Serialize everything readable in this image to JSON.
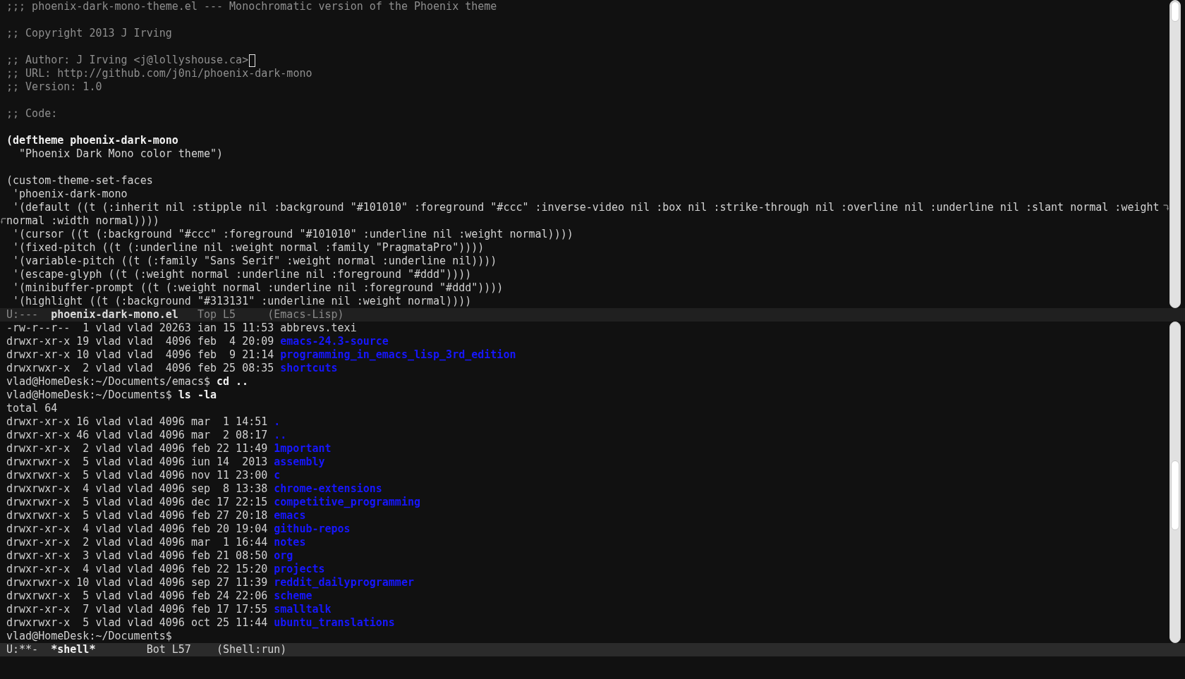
{
  "top_window": {
    "lines": [
      {
        "kind": "comment",
        "text": ";;; phoenix-dark-mono-theme.el --- Monochromatic version of the Phoenix theme",
        "cursor": false
      },
      {
        "kind": "blank",
        "cursor": false
      },
      {
        "kind": "comment",
        "text": ";; Copyright 2013 J Irving",
        "cursor": false
      },
      {
        "kind": "blank",
        "cursor": false
      },
      {
        "kind": "comment",
        "text": ";; Author: J Irving <j@lollyshouse.ca>",
        "cursor": true
      },
      {
        "kind": "comment",
        "text": ";; URL: http://github.com/j0ni/phoenix-dark-mono",
        "cursor": false
      },
      {
        "kind": "comment",
        "text": ";; Version: 1.0",
        "cursor": false
      },
      {
        "kind": "blank",
        "cursor": false
      },
      {
        "kind": "comment",
        "text": ";; Code:",
        "cursor": false
      },
      {
        "kind": "blank",
        "cursor": false
      },
      {
        "kind": "definition",
        "text": "(deftheme phoenix-dark-mono",
        "cursor": false
      },
      {
        "kind": "code",
        "text": "  \"Phoenix Dark Mono color theme\")",
        "cursor": false
      },
      {
        "kind": "blank",
        "cursor": false
      },
      {
        "kind": "code",
        "text": "(custom-theme-set-faces",
        "cursor": false
      },
      {
        "kind": "code",
        "text": " 'phoenix-dark-mono",
        "cursor": false
      },
      {
        "kind": "wrapped",
        "text": " '(default ((t (:inherit nil :stipple nil :background \"#101010\" :foreground \"#ccc\" :inverse-video nil :box nil :strike-through nil :overline nil :underline nil :slant normal :weight",
        "cursor": false
      },
      {
        "kind": "continued",
        "text": "normal :width normal))))",
        "cursor": false
      },
      {
        "kind": "code",
        "text": " '(cursor ((t (:background \"#ccc\" :foreground \"#101010\" :underline nil :weight normal))))",
        "cursor": false
      },
      {
        "kind": "code",
        "text": " '(fixed-pitch ((t (:underline nil :weight normal :family \"PragmataPro\"))))",
        "cursor": false
      },
      {
        "kind": "code",
        "text": " '(variable-pitch ((t (:family \"Sans Serif\" :weight normal :underline nil))))",
        "cursor": false
      },
      {
        "kind": "code",
        "text": " '(escape-glyph ((t (:weight normal :underline nil :foreground \"#ddd\"))))",
        "cursor": false
      },
      {
        "kind": "code",
        "text": " '(minibuffer-prompt ((t (:weight normal :underline nil :foreground \"#ddd\"))))",
        "cursor": false
      },
      {
        "kind": "code",
        "text": " '(highlight ((t (:background \"#313131\" :underline nil :weight normal))))",
        "cursor": false
      }
    ],
    "mode_line": {
      "status": "U:---",
      "buffer": "phoenix-dark-mono.el",
      "position": "Top L5",
      "mode": "(Emacs-Lisp)",
      "active": false
    }
  },
  "bottom_window": {
    "lines": [
      {
        "kind": "entry",
        "info": "-rw-r--r--  1 vlad vlad 20263 ian 15 11:53",
        "name": "abbrevs.texi",
        "directory": false
      },
      {
        "kind": "entry",
        "info": "drwxr-xr-x 19 vlad vlad  4096 feb  4 20:09",
        "name": "emacs-24.3-source",
        "directory": true
      },
      {
        "kind": "entry",
        "info": "drwxr-xr-x 10 vlad vlad  4096 feb  9 21:14",
        "name": "programming_in_emacs_lisp_3rd_edition",
        "directory": true
      },
      {
        "kind": "entry",
        "info": "drwxrwxr-x  2 vlad vlad  4096 feb 25 08:35",
        "name": "shortcuts",
        "directory": true
      },
      {
        "kind": "prompt",
        "prompt": "vlad@HomeDesk:~/Documents/emacs$",
        "command": "cd .."
      },
      {
        "kind": "prompt",
        "prompt": "vlad@HomeDesk:~/Documents$",
        "command": "ls -la"
      },
      {
        "kind": "output",
        "text": "total 64"
      },
      {
        "kind": "entry",
        "info": "drwxr-xr-x 16 vlad vlad 4096 mar  1 14:51",
        "name": ".",
        "directory": true
      },
      {
        "kind": "entry",
        "info": "drwxr-xr-x 46 vlad vlad 4096 mar  2 08:17",
        "name": "..",
        "directory": true
      },
      {
        "kind": "entry",
        "info": "drwxr-xr-x  2 vlad vlad 4096 feb 22 11:49",
        "name": "1mportant",
        "directory": true
      },
      {
        "kind": "entry",
        "info": "drwxrwxr-x  5 vlad vlad 4096 iun 14  2013",
        "name": "assembly",
        "directory": true
      },
      {
        "kind": "entry",
        "info": "drwxrwxr-x  5 vlad vlad 4096 nov 11 23:00",
        "name": "c",
        "directory": true
      },
      {
        "kind": "entry",
        "info": "drwxrwxr-x  4 vlad vlad 4096 sep  8 13:38",
        "name": "chrome-extensions",
        "directory": true
      },
      {
        "kind": "entry",
        "info": "drwxrwxr-x  5 vlad vlad 4096 dec 17 22:15",
        "name": "competitive_programming",
        "directory": true
      },
      {
        "kind": "entry",
        "info": "drwxrwxr-x  5 vlad vlad 4096 feb 27 20:18",
        "name": "emacs",
        "directory": true
      },
      {
        "kind": "entry",
        "info": "drwxr-xr-x  4 vlad vlad 4096 feb 20 19:04",
        "name": "github-repos",
        "directory": true
      },
      {
        "kind": "entry",
        "info": "drwxr-xr-x  2 vlad vlad 4096 mar  1 16:44",
        "name": "notes",
        "directory": true
      },
      {
        "kind": "entry",
        "info": "drwxr-xr-x  3 vlad vlad 4096 feb 21 08:50",
        "name": "org",
        "directory": true
      },
      {
        "kind": "entry",
        "info": "drwxr-xr-x  4 vlad vlad 4096 feb 22 15:20",
        "name": "projects",
        "directory": true
      },
      {
        "kind": "entry",
        "info": "drwxrwxr-x 10 vlad vlad 4096 sep 27 11:39",
        "name": "reddit_dailyprogrammer",
        "directory": true
      },
      {
        "kind": "entry",
        "info": "drwxrwxr-x  5 vlad vlad 4096 feb 24 22:06",
        "name": "scheme",
        "directory": true
      },
      {
        "kind": "entry",
        "info": "drwxr-xr-x  7 vlad vlad 4096 feb 17 17:55",
        "name": "smalltalk",
        "directory": true
      },
      {
        "kind": "entry",
        "info": "drwxrwxr-x  5 vlad vlad 4096 oct 25 11:44",
        "name": "ubuntu_translations",
        "directory": true
      },
      {
        "kind": "prompt",
        "prompt": "vlad@HomeDesk:~/Documents$"
      }
    ],
    "mode_line": {
      "status": "U:**-",
      "buffer": "*shell*",
      "position": "Bot L57",
      "mode": "(Shell:run)",
      "active": true
    }
  }
}
